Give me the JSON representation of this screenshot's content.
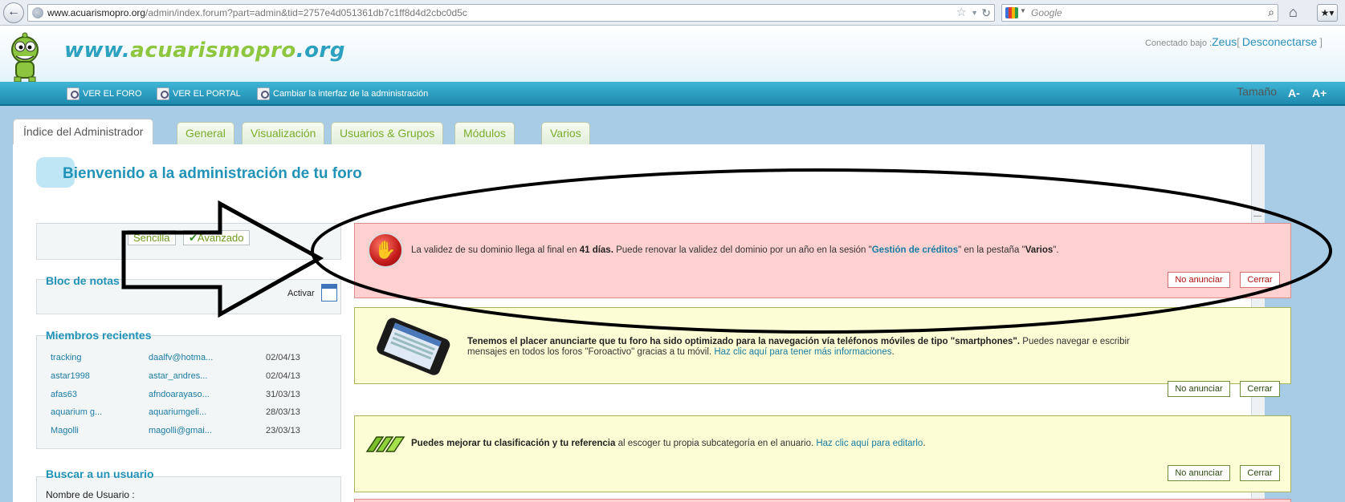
{
  "browser": {
    "back_glyph": "←",
    "url_host": "www.acuarismopro.org",
    "url_path": "/admin/index.forum?part=admin&tid=2757e4d051361db7c1ff8d4d2cbc0d5c",
    "search_placeholder": "Google"
  },
  "header": {
    "site_title_prefix": "www.",
    "site_title_mid": "acuarismopro",
    "site_title_suffix": ".org",
    "connected_label": "Conectado bajo :",
    "username": "Zeus",
    "bracket_open": "[",
    "logout_label": "Desconectarse",
    "bracket_close": "]"
  },
  "toolbar": {
    "view_forum": "VER EL FORO",
    "view_portal": "VER EL PORTAL",
    "change_interface": "Cambiar la interfaz de la administración",
    "size_label": "Tamaño",
    "size_decrease": "A-",
    "size_increase": "A+"
  },
  "tabs": [
    {
      "label": "Índice del Administrador",
      "active": true
    },
    {
      "label": "General"
    },
    {
      "label": "Visualización"
    },
    {
      "label": "Usuarios & Grupos"
    },
    {
      "label": "Módulos"
    },
    {
      "label": "Varios"
    }
  ],
  "welcome_title": "Bienvenido a la administración de tu foro",
  "mode": {
    "simple_label": "Sencilla",
    "advanced_label": "Avanzado",
    "advanced_checked": true
  },
  "notes": {
    "title": "Bloc de notas",
    "activate_label": "Activar"
  },
  "recent_members": {
    "title": "Miembros recientes",
    "rows": [
      {
        "user": "tracking",
        "email": "daalfv@hotma...",
        "date": "02/04/13"
      },
      {
        "user": "astar1998",
        "email": "astar_andres...",
        "date": "02/04/13"
      },
      {
        "user": "afas63",
        "email": "afndoarayaso...",
        "date": "31/03/13"
      },
      {
        "user": "aquarium g...",
        "email": "aquariumgeli...",
        "date": "28/03/13"
      },
      {
        "user": "Magolli",
        "email": "magolli@gmai...",
        "date": "23/03/13"
      }
    ]
  },
  "search_user": {
    "title": "Buscar a un usuario",
    "name_label": "Nombre de Usuario :"
  },
  "notices": [
    {
      "type": "red",
      "text_pre": "La validez de su dominio llega al final en ",
      "text_bold": "41 días.",
      "text_mid": " Puede renovar la validez del dominio por un año en la sesión \"",
      "link": "Gestión de créditos",
      "text_mid2": "\" en la pestaña \"",
      "tab_bold": "Varios",
      "text_end": "\".",
      "dismiss_label": "No anunciar",
      "close_label": "Cerrar"
    },
    {
      "type": "yellow",
      "text_bold": "Tenemos el placer anunciarte que tu foro ha sido optimizado para la navegación vía teléfonos móviles de tipo \"smartphones\".",
      "text_mid": " Puedes navegar e escribir",
      "line2": "mensajes en todos los foros \"Foroactivo\" gracias a tu móvil. ",
      "link": "Haz clic aquí para tener más informaciones",
      "text_end": ".",
      "dismiss_label": "No anunciar",
      "close_label": "Cerrar"
    },
    {
      "type": "yellow",
      "text_bold": "Puedes mejorar tu clasificación y tu referencia",
      "text_mid": " al escoger tu propia subcategoría en el anuario. ",
      "link": "Haz clic aquí para editarlo",
      "text_end": ".",
      "dismiss_label": "No anunciar",
      "close_label": "Cerrar"
    }
  ],
  "colors": {
    "accent_blue": "#2293b8",
    "accent_green": "#8ec63f",
    "alert_red": "#ffd0d0",
    "notice_yellow": "#fcfdd4"
  }
}
